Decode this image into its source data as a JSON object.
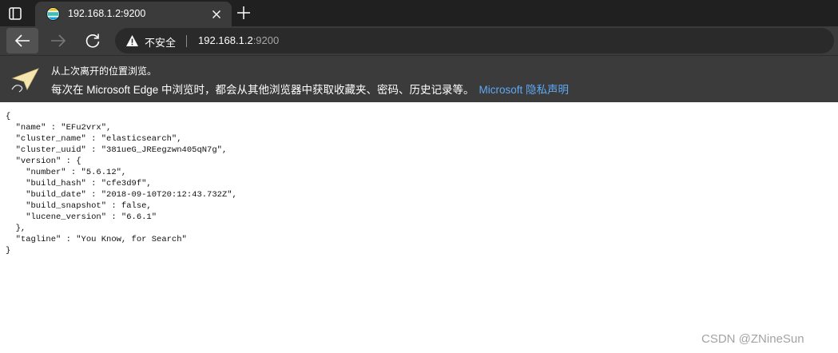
{
  "tab": {
    "title": "192.168.1.2:9200",
    "favicon": "elasticsearch-logo-icon",
    "close_icon": "close-icon"
  },
  "toolbar": {
    "back_icon": "back-arrow-icon",
    "forward_icon": "forward-arrow-icon",
    "refresh_icon": "refresh-icon",
    "security_label": "不安全",
    "url_host": "192.168.1.2",
    "url_port": ":9200"
  },
  "infobar": {
    "icon": "paper-plane-icon",
    "line1": "从上次离开的位置浏览。",
    "line2": "每次在 Microsoft Edge 中浏览时，都会从其他浏览器中获取收藏夹、密码、历史记录等。",
    "link": "Microsoft 隐私声明"
  },
  "content": {
    "json_text": "{\n  \"name\" : \"EFu2vrx\",\n  \"cluster_name\" : \"elasticsearch\",\n  \"cluster_uuid\" : \"381ueG_JREegzwn405qN7g\",\n  \"version\" : {\n    \"number\" : \"5.6.12\",\n    \"build_hash\" : \"cfe3d9f\",\n    \"build_date\" : \"2018-09-10T20:12:43.732Z\",\n    \"build_snapshot\" : false,\n    \"lucene_version\" : \"6.6.1\"\n  },\n  \"tagline\" : \"You Know, for Search\"\n}"
  },
  "watermark": "CSDN @ZNineSun",
  "colors": {
    "tabstrip_bg": "#202020",
    "toolbar_bg": "#3b3b3b",
    "address_bg": "#2a2a2a",
    "link": "#5ea9f5"
  }
}
